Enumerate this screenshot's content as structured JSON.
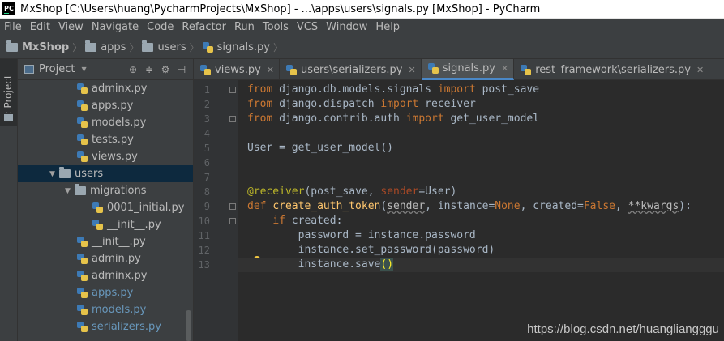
{
  "window": {
    "title": "MxShop [C:\\Users\\huang\\PycharmProjects\\MxShop] - ...\\apps\\users\\signals.py [MxShop] - PyCharm",
    "logo_text": "PC"
  },
  "menu": [
    "File",
    "Edit",
    "View",
    "Navigate",
    "Code",
    "Refactor",
    "Run",
    "Tools",
    "VCS",
    "Window",
    "Help"
  ],
  "breadcrumb": [
    "MxShop",
    "apps",
    "users",
    "signals.py"
  ],
  "side_tab_label": "1: Project",
  "project_panel": {
    "title": "Project",
    "tree": [
      {
        "name": "adminx.py",
        "depth": 2,
        "type": "py"
      },
      {
        "name": "apps.py",
        "depth": 2,
        "type": "py"
      },
      {
        "name": "models.py",
        "depth": 2,
        "type": "py"
      },
      {
        "name": "tests.py",
        "depth": 2,
        "type": "py"
      },
      {
        "name": "views.py",
        "depth": 2,
        "type": "py"
      },
      {
        "name": "users",
        "depth": 1,
        "type": "folder",
        "selected": true
      },
      {
        "name": "migrations",
        "depth": 2,
        "type": "folder"
      },
      {
        "name": "0001_initial.py",
        "depth": 3,
        "type": "py"
      },
      {
        "name": "__init__.py",
        "depth": 3,
        "type": "py"
      },
      {
        "name": "__init__.py",
        "depth": 2,
        "type": "py"
      },
      {
        "name": "admin.py",
        "depth": 2,
        "type": "py"
      },
      {
        "name": "adminx.py",
        "depth": 2,
        "type": "py"
      },
      {
        "name": "apps.py",
        "depth": 2,
        "type": "py",
        "modified": true
      },
      {
        "name": "models.py",
        "depth": 2,
        "type": "py",
        "modified": true
      },
      {
        "name": "serializers.py",
        "depth": 2,
        "type": "py",
        "modified": true
      }
    ]
  },
  "tabs": [
    {
      "label": "views.py",
      "active": false
    },
    {
      "label": "users\\serializers.py",
      "active": false
    },
    {
      "label": "signals.py",
      "active": true
    },
    {
      "label": "rest_framework\\serializers.py",
      "active": false
    }
  ],
  "code": {
    "current_line": 13,
    "lines": [
      [
        [
          "kw",
          "from "
        ],
        [
          "df",
          "django.db.models.signals "
        ],
        [
          "kw",
          "import "
        ],
        [
          "df",
          "post_save"
        ]
      ],
      [
        [
          "kw",
          "from "
        ],
        [
          "df",
          "django.dispatch "
        ],
        [
          "kw",
          "import "
        ],
        [
          "df",
          "receiver"
        ]
      ],
      [
        [
          "kw",
          "from "
        ],
        [
          "df",
          "django.contrib.auth "
        ],
        [
          "kw",
          "import "
        ],
        [
          "df",
          "get_user_model"
        ]
      ],
      [],
      [
        [
          "df",
          "User = get_user_model()"
        ]
      ],
      [],
      [],
      [
        [
          "dec",
          "@receiver"
        ],
        [
          "df",
          "(post_save, "
        ],
        [
          "pm",
          "sender"
        ],
        [
          "df",
          "=User)"
        ]
      ],
      [
        [
          "kw",
          "def "
        ],
        [
          "fn",
          "create_auth_token"
        ],
        [
          "df",
          "("
        ],
        [
          "under",
          "sender"
        ],
        [
          "df",
          ", instance="
        ],
        [
          "kw",
          "None"
        ],
        [
          "df",
          ", created="
        ],
        [
          "kw",
          "False"
        ],
        [
          "df",
          ", "
        ],
        [
          "under",
          "**kwargs"
        ],
        [
          "df",
          "):"
        ]
      ],
      [
        [
          "df",
          "    "
        ],
        [
          "kw",
          "if "
        ],
        [
          "df",
          "created:"
        ]
      ],
      [
        [
          "df",
          "        password = instance.password"
        ]
      ],
      [
        [
          "df",
          "        instance.set_password(password)"
        ]
      ],
      [
        [
          "df",
          "        instance.save"
        ],
        [
          "brace",
          "()"
        ]
      ]
    ]
  },
  "watermark": "https://blog.csdn.net/huangliangggu"
}
